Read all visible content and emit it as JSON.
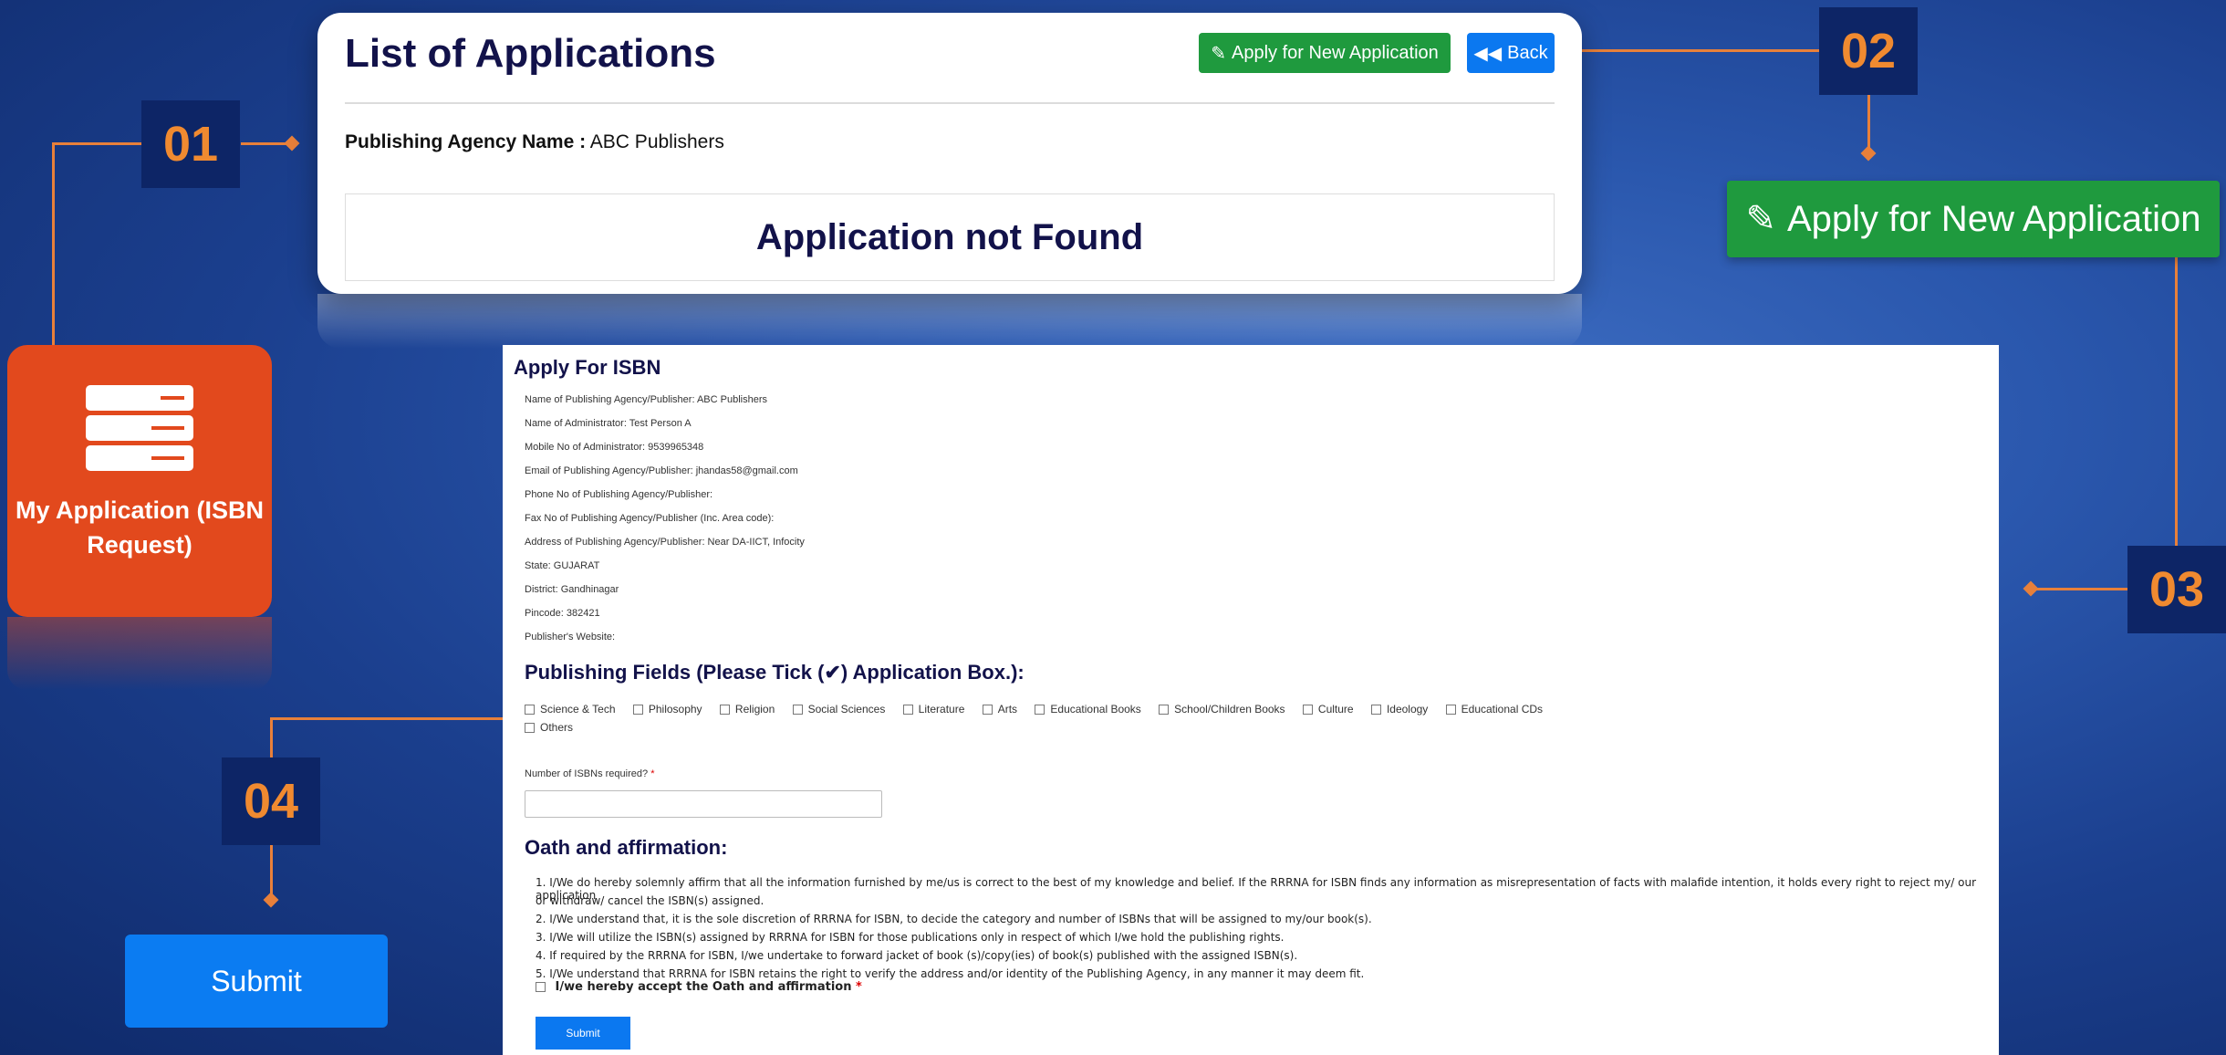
{
  "top_card": {
    "title": "List of Applications",
    "apply_button": "Apply for New Application",
    "back_button": "Back",
    "agency_label": "Publishing Agency Name :",
    "agency_value": "ABC Publishers",
    "not_found": "Application not Found"
  },
  "tile": {
    "label": "My Application (ISBN Request)",
    "icon": "server-list-icon"
  },
  "big_apply_button": "Apply for New Application",
  "badges": {
    "b1": "01",
    "b2": "02",
    "b3": "03",
    "b4": "04"
  },
  "form": {
    "title": "Apply For ISBN",
    "fields": [
      "Name of Publishing Agency/Publisher: ABC Publishers",
      "Name of Administrator: Test Person A",
      "Mobile No of Administrator: 9539965348",
      "Email of Publishing Agency/Publisher: jhandas58@gmail.com",
      "Phone No of Publishing Agency/Publisher:",
      "Fax No of Publishing Agency/Publisher (Inc. Area code):",
      "Address of Publishing Agency/Publisher: Near DA-IICT, Infocity",
      "State: GUJARAT",
      "District: Gandhinagar",
      "Pincode: 382421",
      "Publisher's Website:"
    ],
    "fields_heading": "Publishing Fields (Please Tick (✔) Application Box.):",
    "publishing_fields": [
      "Science & Tech",
      "Philosophy",
      "Religion",
      "Social Sciences",
      "Literature",
      "Arts",
      "Educational Books",
      "School/Children Books",
      "Culture",
      "Ideology",
      "Educational CDs"
    ],
    "publishing_fields_row2": [
      "Others"
    ],
    "isbn_count_label": "Number of ISBNs required?",
    "required_mark": "*",
    "oath_heading": "Oath and affirmation:",
    "oath_lines": [
      "1. I/We do hereby solemnly affirm that all the information furnished by me/us is correct to the best of my knowledge and belief. If the RRRNA for ISBN finds any information as misrepresentation of facts with malafide intention, it holds every right to reject my/ our application",
      "or withdraw/ cancel the ISBN(s) assigned.",
      "2. I/We understand that, it is the sole discretion of RRRNA for ISBN, to decide the category and number of ISBNs that will be assigned to my/our book(s).",
      "3. I/We will utilize the ISBN(s) assigned by RRRNA for ISBN for those publications only in respect of which I/we hold the publishing rights.",
      "4. If required by the RRRNA for ISBN, I/we undertake to forward jacket of book (s)/copy(ies) of book(s) published with the assigned ISBN(s).",
      "5. I/We understand that RRRNA for ISBN retains the right to verify the address and/or identity of the Publishing Agency, in any manner it may deem fit."
    ],
    "accept_label": "I/we hereby accept the Oath and affirmation",
    "submit": "Submit"
  },
  "big_submit": "Submit"
}
